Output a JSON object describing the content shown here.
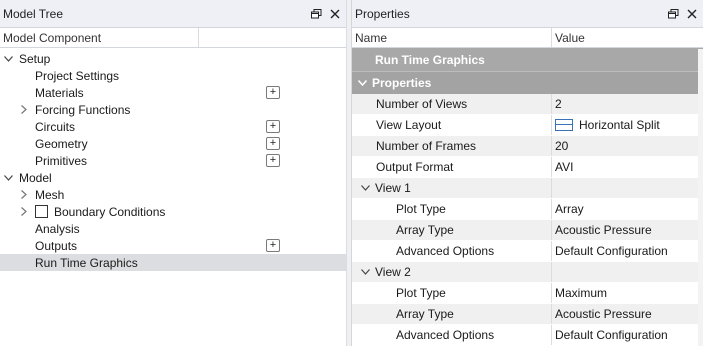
{
  "model_tree": {
    "title": "Model Tree",
    "column_header": "Model Component",
    "rows": [
      {
        "label": "Setup",
        "depth": 0,
        "expander": "open",
        "plus": false
      },
      {
        "label": "Project Settings",
        "depth": 1,
        "expander": "none",
        "plus": false
      },
      {
        "label": "Materials",
        "depth": 1,
        "expander": "none",
        "plus": true
      },
      {
        "label": "Forcing Functions",
        "depth": 1,
        "expander": "closed",
        "plus": false
      },
      {
        "label": "Circuits",
        "depth": 1,
        "expander": "none",
        "plus": true
      },
      {
        "label": "Geometry",
        "depth": 1,
        "expander": "none",
        "plus": true
      },
      {
        "label": "Primitives",
        "depth": 1,
        "expander": "none",
        "plus": true
      },
      {
        "label": "Model",
        "depth": 0,
        "expander": "open",
        "plus": false
      },
      {
        "label": "Mesh",
        "depth": 1,
        "expander": "closed",
        "plus": false
      },
      {
        "label": "Boundary Conditions",
        "depth": 1,
        "expander": "closed",
        "plus": false,
        "checkbox": true
      },
      {
        "label": "Analysis",
        "depth": 1,
        "expander": "none",
        "plus": false
      },
      {
        "label": "Outputs",
        "depth": 1,
        "expander": "none",
        "plus": true
      },
      {
        "label": "Run Time Graphics",
        "depth": 1,
        "expander": "none",
        "plus": false,
        "selected": true
      }
    ],
    "plus_label": "+"
  },
  "properties": {
    "title": "Properties",
    "col_name": "Name",
    "col_value": "Value",
    "header_bar": "Run Time Graphics",
    "section": "Properties",
    "rows": [
      {
        "kind": "prop",
        "name": "Number of Views",
        "value": "2",
        "indent": 1,
        "alt": true
      },
      {
        "kind": "prop",
        "name": "View Layout",
        "value": "Horizontal Split",
        "indent": 1,
        "alt": false,
        "icon": "horizontal-split-icon"
      },
      {
        "kind": "prop",
        "name": "Number of Frames",
        "value": "20",
        "indent": 1,
        "alt": true
      },
      {
        "kind": "prop",
        "name": "Output Format",
        "value": "AVI",
        "indent": 1,
        "alt": false
      },
      {
        "kind": "group",
        "name": "View 1",
        "value": "",
        "indent": 0,
        "alt": true
      },
      {
        "kind": "prop",
        "name": "Plot Type",
        "value": "Array",
        "indent": 2,
        "alt": false
      },
      {
        "kind": "prop",
        "name": "Array Type",
        "value": "Acoustic Pressure",
        "indent": 2,
        "alt": true
      },
      {
        "kind": "prop",
        "name": "Advanced Options",
        "value": "Default Configuration",
        "indent": 2,
        "alt": false
      },
      {
        "kind": "group",
        "name": "View 2",
        "value": "",
        "indent": 0,
        "alt": true
      },
      {
        "kind": "prop",
        "name": "Plot Type",
        "value": "Maximum",
        "indent": 2,
        "alt": false
      },
      {
        "kind": "prop",
        "name": "Array Type",
        "value": "Acoustic Pressure",
        "indent": 2,
        "alt": true
      },
      {
        "kind": "prop",
        "name": "Advanced Options",
        "value": "Default Configuration",
        "indent": 2,
        "alt": false
      }
    ]
  },
  "icons": {
    "float": "restore-window-icon",
    "close": "close-icon",
    "expand_open": "chevron-down-icon",
    "expand_closed": "chevron-right-icon"
  }
}
